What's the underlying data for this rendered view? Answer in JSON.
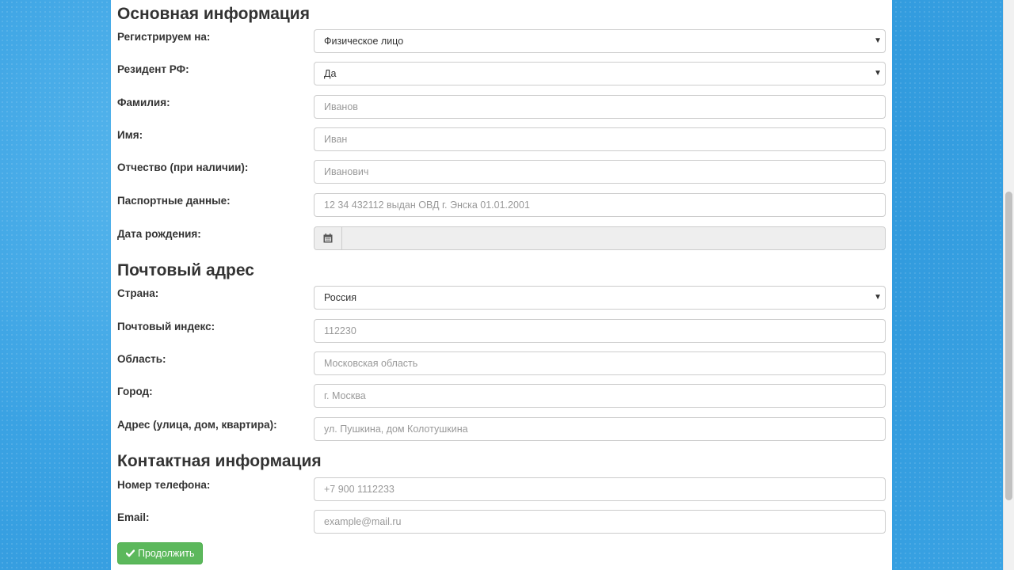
{
  "sections": {
    "basic": {
      "title": "Основная информация",
      "registration_type": {
        "label": "Регистрируем на:",
        "value": "Физическое лицо"
      },
      "resident": {
        "label": "Резидент РФ:",
        "value": "Да"
      },
      "last_name": {
        "label": "Фамилия:",
        "placeholder": "Иванов"
      },
      "first_name": {
        "label": "Имя:",
        "placeholder": "Иван"
      },
      "patronymic": {
        "label": "Отчество (при наличии):",
        "placeholder": "Иванович"
      },
      "passport": {
        "label": "Паспортные данные:",
        "placeholder": "12 34 432112 выдан ОВД г. Энска 01.01.2001"
      },
      "birth_date": {
        "label": "Дата рождения:",
        "value": ""
      }
    },
    "postal": {
      "title": "Почтовый адрес",
      "country": {
        "label": "Страна:",
        "value": "Россия"
      },
      "postcode": {
        "label": "Почтовый индекс:",
        "placeholder": "112230"
      },
      "region": {
        "label": "Область:",
        "placeholder": "Московская область"
      },
      "city": {
        "label": "Город:",
        "placeholder": "г. Москва"
      },
      "address": {
        "label": "Адрес (улица, дом, квартира):",
        "placeholder": "ул. Пушкина, дом Колотушкина"
      }
    },
    "contact": {
      "title": "Контактная информация",
      "phone": {
        "label": "Номер телефона:",
        "placeholder": "+7 900 1112233"
      },
      "email": {
        "label": "Email:",
        "placeholder": "example@mail.ru"
      }
    }
  },
  "continue_button": {
    "label": "Продолжить",
    "icon": "check-icon",
    "color": "#5cb85c"
  },
  "icons": {
    "calendar": "calendar-icon",
    "dropdown": "dropdown-caret-icon"
  },
  "colors": {
    "background": "#3aa2e3",
    "panel": "#ffffff",
    "text": "#333333",
    "placeholder": "#999999",
    "border": "#cccccc"
  }
}
